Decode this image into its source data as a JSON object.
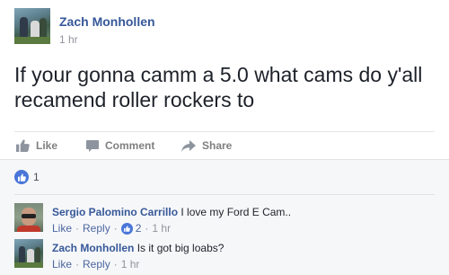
{
  "post": {
    "author": "Zach Monhollen",
    "time": "1 hr",
    "text": "If your gonna camm a 5.0 what cams do y'all recamend roller rockers to"
  },
  "actions": {
    "like": "Like",
    "comment": "Comment",
    "share": "Share"
  },
  "reactions": {
    "count": "1",
    "icon": "thumbs-up-icon",
    "color": "#4a76d8"
  },
  "comments": [
    {
      "author": "Sergio Palomino Carrillo",
      "text": "I love my Ford E Cam..",
      "like_label": "Like",
      "reply_label": "Reply",
      "like_count": "2",
      "time": "1 hr"
    },
    {
      "author": "Zach Monhollen",
      "text": "Is it got big loabs?",
      "like_label": "Like",
      "reply_label": "Reply",
      "time": "1 hr"
    }
  ],
  "colors": {
    "link": "#365899",
    "meta": "#90949c",
    "action": "#7f7f7f",
    "comments_bg": "#f6f7f9"
  }
}
